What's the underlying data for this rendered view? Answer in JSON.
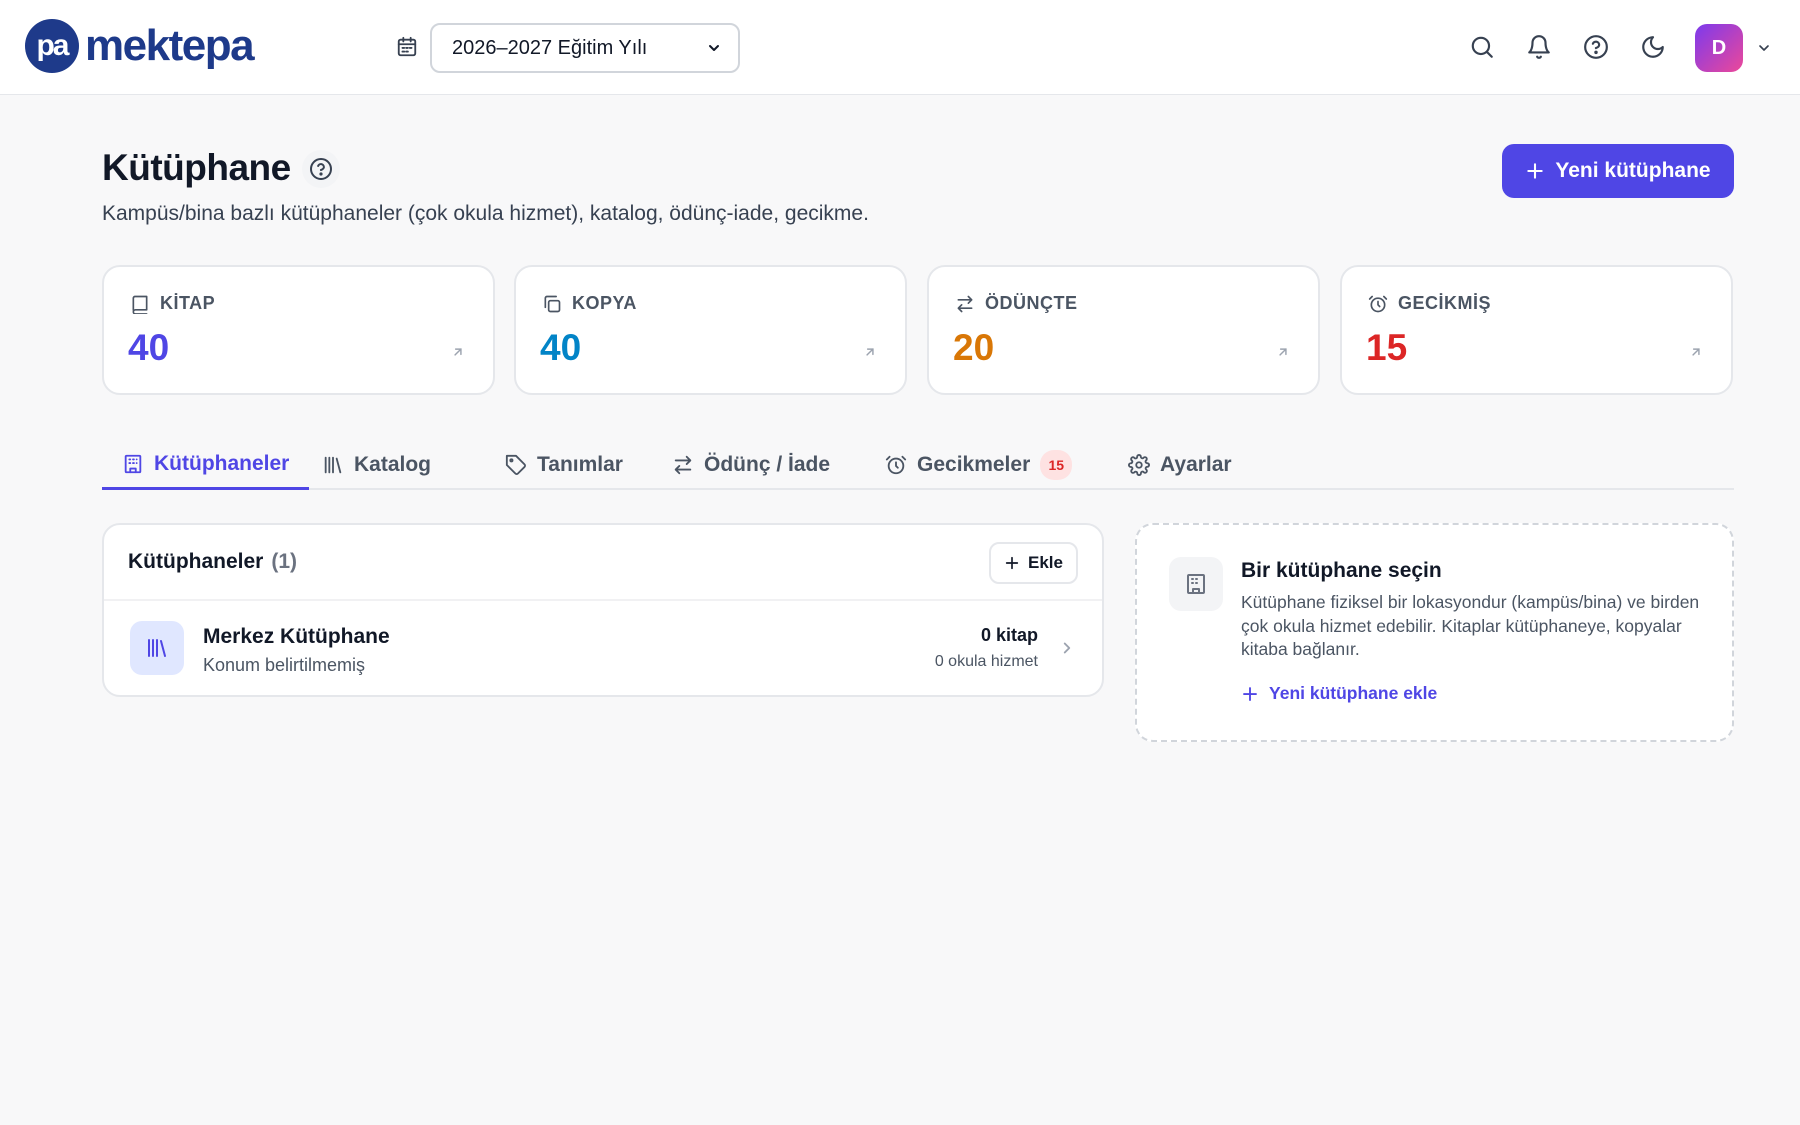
{
  "brand": {
    "logo_mark": "pa",
    "name": "mektepa"
  },
  "header": {
    "year_select": {
      "value": "2026–2027 Eğitim Yılı"
    },
    "avatar_initial": "D",
    "icons": [
      "search-icon",
      "bell-icon",
      "help-icon",
      "moon-icon",
      "chevron-down-icon"
    ]
  },
  "page": {
    "title": "Kütüphane",
    "subtitle": "Kampüs/bina bazlı kütüphaneler (çok okula hizmet), katalog, ödünç-iade, gecikme.",
    "new_button": "Yeni kütüphane"
  },
  "stats": [
    {
      "label": "KİTAP",
      "value": "40",
      "color": "#4f46e5",
      "icon": "book-icon"
    },
    {
      "label": "KOPYA",
      "value": "40",
      "color": "#0284c7",
      "icon": "copy-icon"
    },
    {
      "label": "ÖDÜNÇTE",
      "value": "20",
      "color": "#d97706",
      "icon": "swap-icon"
    },
    {
      "label": "GECİKMİŞ",
      "value": "15",
      "color": "#dc2626",
      "icon": "alarm-icon"
    }
  ],
  "tabs": [
    {
      "label": "Kütüphaneler",
      "active": true,
      "icon": "building-icon"
    },
    {
      "label": "Katalog",
      "icon": "library-icon"
    },
    {
      "label": "Tanımlar",
      "icon": "tag-icon"
    },
    {
      "label": "Ödünç / İade",
      "icon": "swap-icon"
    },
    {
      "label": "Gecikmeler",
      "icon": "alarm-icon",
      "badge": "15"
    },
    {
      "label": "Ayarlar",
      "icon": "gear-icon"
    }
  ],
  "libraries_panel": {
    "title": "Kütüphaneler",
    "count": "(1)",
    "add_button": "Ekle",
    "items": [
      {
        "name": "Merkez Kütüphane",
        "location": "Konum belirtilmemiş",
        "books": "0 kitap",
        "schools": "0 okula hizmet"
      }
    ]
  },
  "select_card": {
    "title": "Bir kütüphane seçin",
    "description": "Kütüphane fiziksel bir lokasyondur (kampüs/bina) ve birden çok okula hizmet edebilir. Kitaplar kütüphaneye, kopyalar kitaba bağlanır.",
    "link": "Yeni kütüphane ekle"
  },
  "colors": {
    "accent": "#4f46e5",
    "brand": "#1e3a8a"
  }
}
